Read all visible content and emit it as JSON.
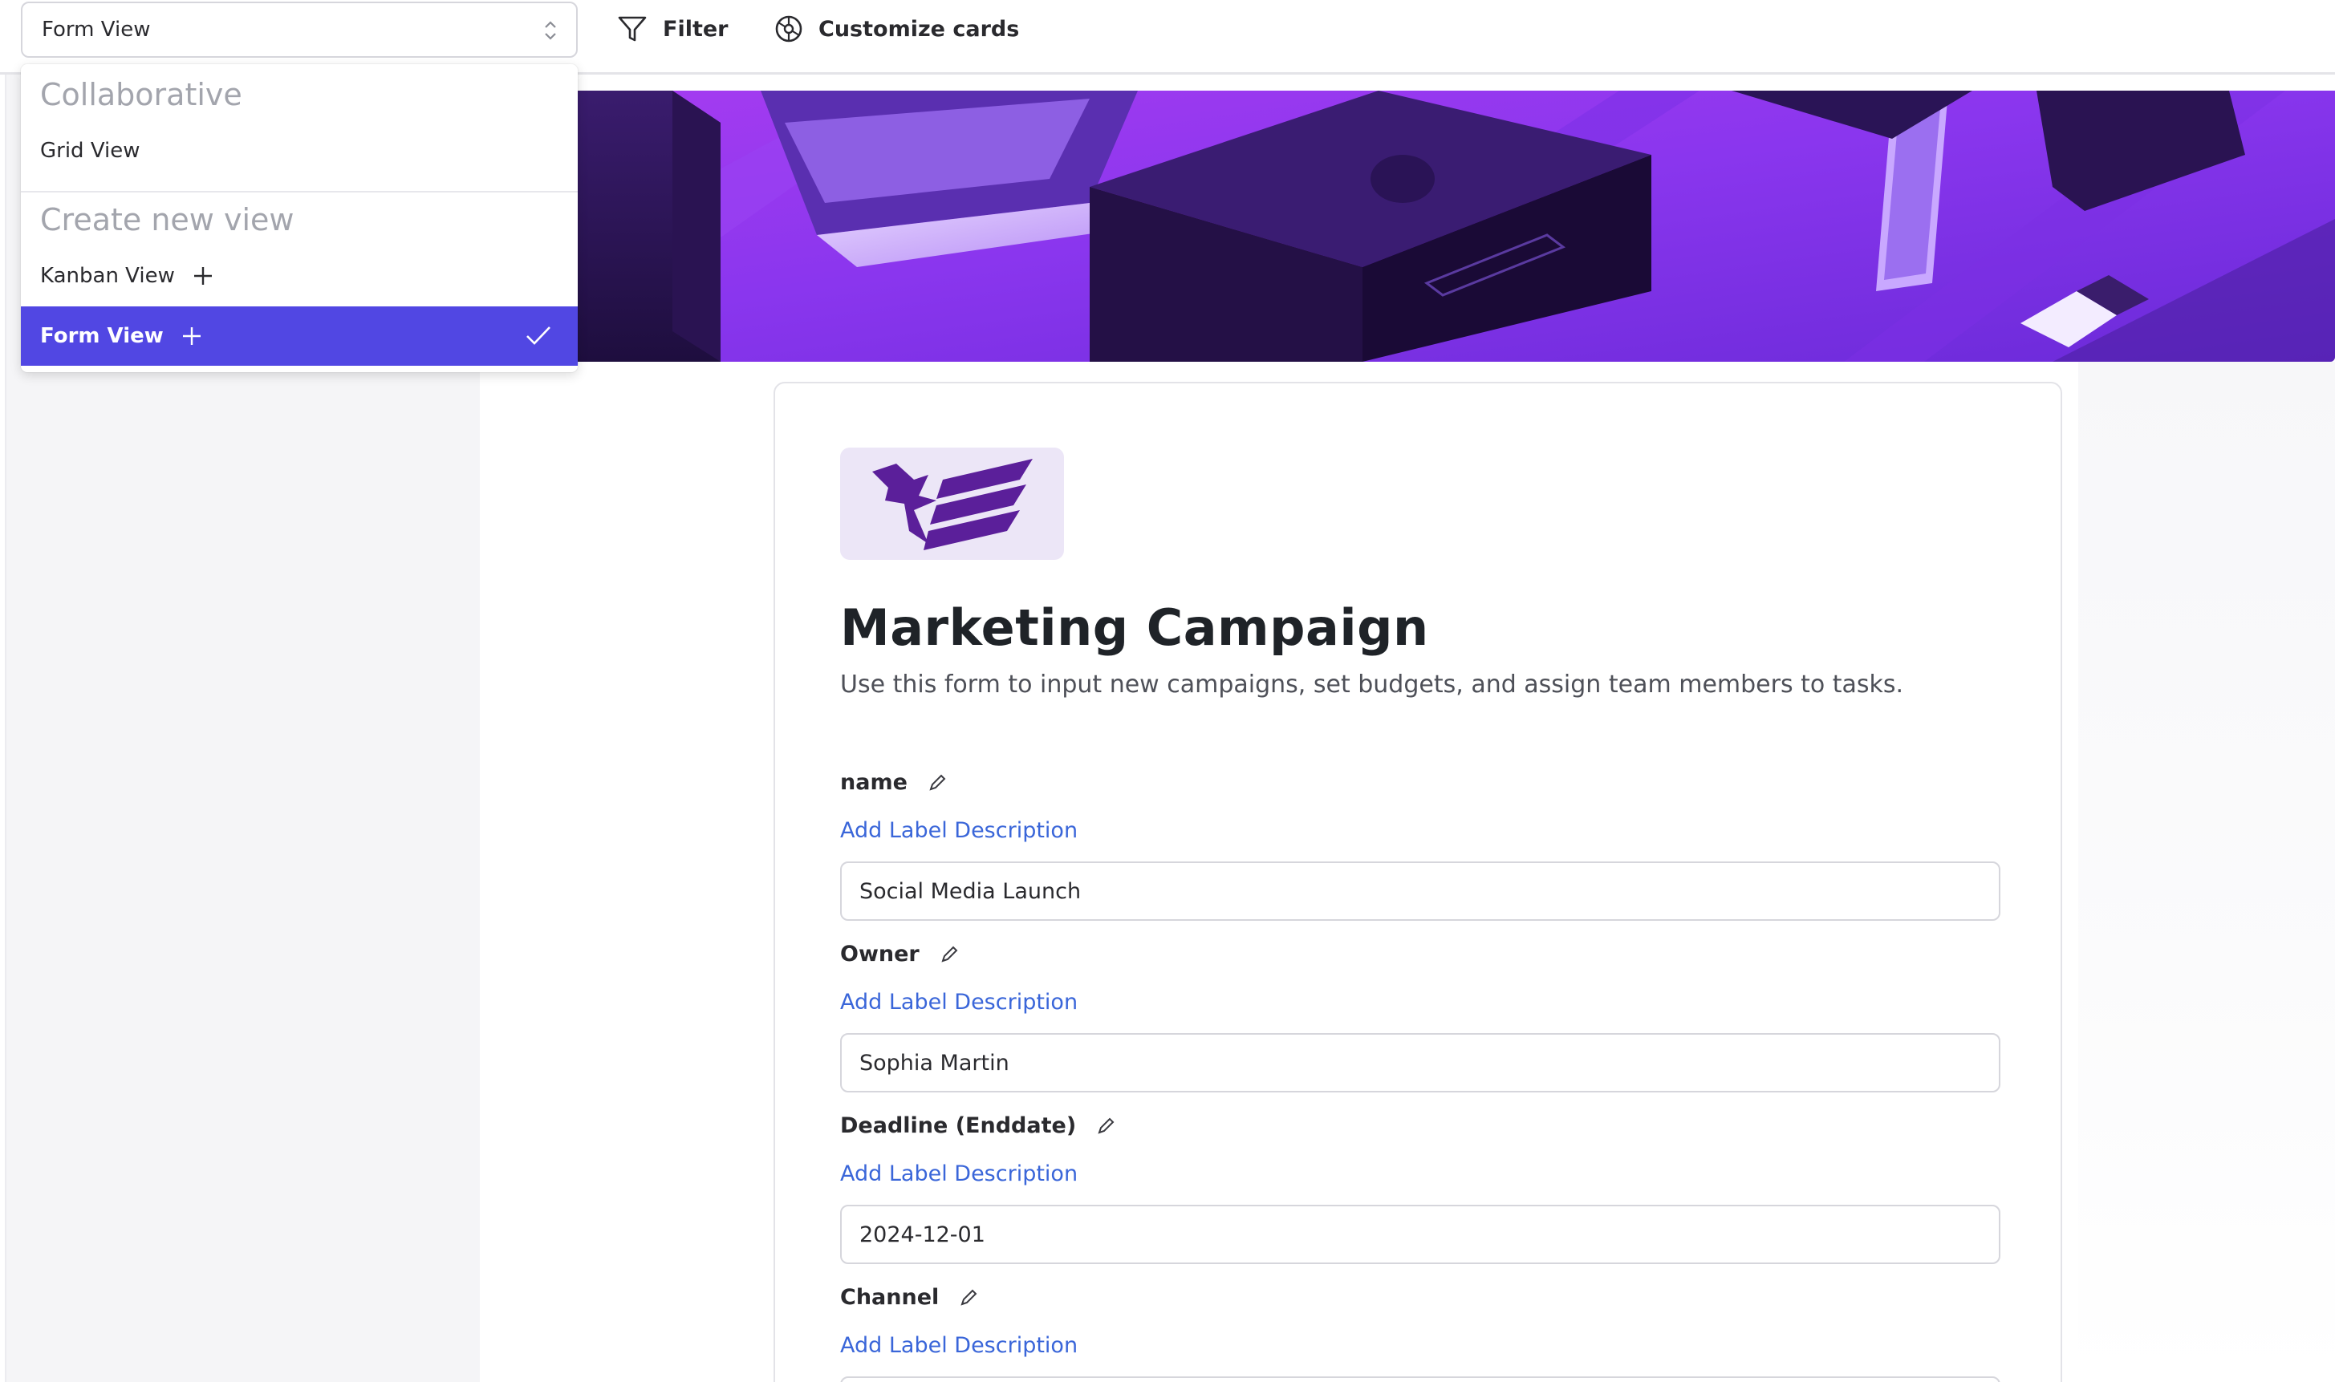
{
  "toolbar": {
    "view_select_value": "Form View",
    "filter_label": "Filter",
    "customize_label": "Customize cards"
  },
  "view_menu": {
    "section_collaborative": "Collaborative",
    "grid_view": "Grid View",
    "section_create": "Create new view",
    "kanban_view": "Kanban View",
    "form_view": "Form View"
  },
  "form": {
    "title": "Marketing Campaign",
    "description": "Use this form to input new campaigns, set budgets, and assign team members to tasks.",
    "add_description_label": "Add Label Description",
    "fields": [
      {
        "label": "name",
        "value": "Social Media Launch"
      },
      {
        "label": "Owner",
        "value": "Sophia Martin"
      },
      {
        "label": "Deadline (Enddate)",
        "value": "2024-12-01"
      },
      {
        "label": "Channel",
        "value": ""
      }
    ]
  },
  "colors": {
    "accent": "#5147e3",
    "link": "#3a66d9",
    "banner_purple": "#7b2ff0"
  }
}
